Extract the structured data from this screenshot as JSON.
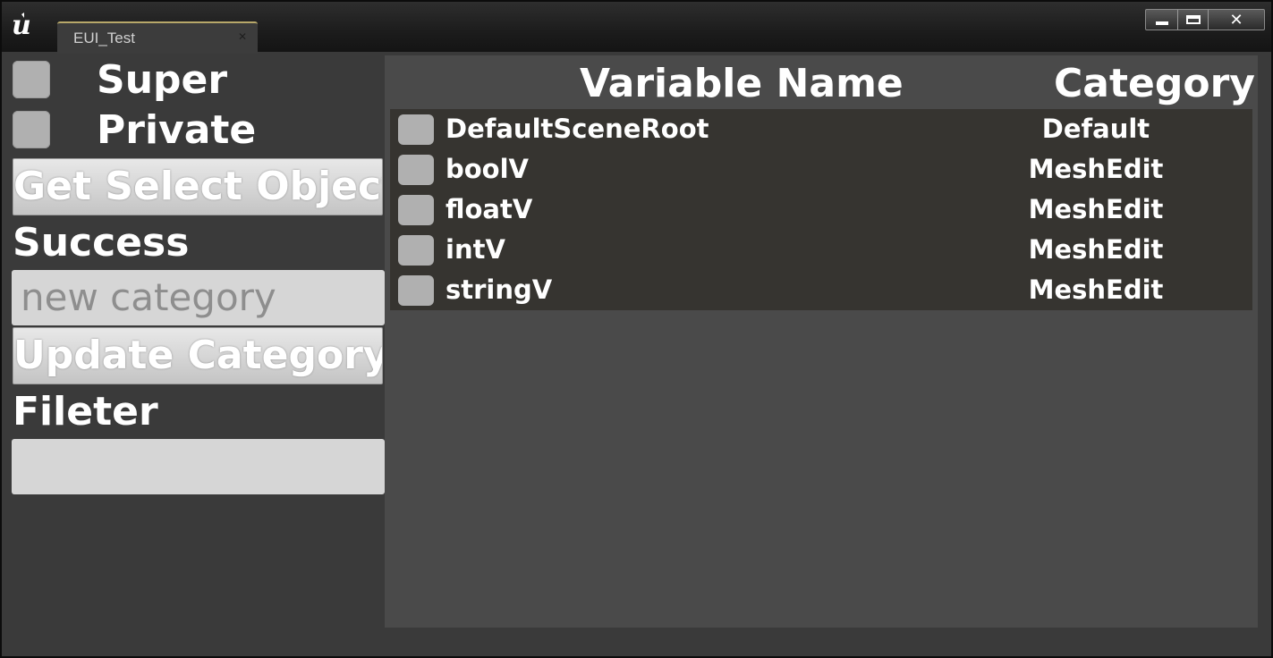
{
  "window": {
    "tab_title": "EUI_Test",
    "tab_close_icon": "close-icon",
    "controls": {
      "minimize_icon": "minimize-icon",
      "maximize_icon": "maximize-icon",
      "close_label": "✕"
    }
  },
  "left_panel": {
    "super_label": "Super",
    "private_label": "Private",
    "get_select_objects_label": "Get Select Objects",
    "status_text": "Success",
    "category_input": {
      "value": "",
      "placeholder": "new category"
    },
    "update_category_label": "Update Category",
    "filter_label": "Fileter",
    "filter_input": {
      "value": "",
      "placeholder": ""
    }
  },
  "variable_table": {
    "headers": {
      "name": "Variable Name",
      "category": "Category"
    },
    "rows": [
      {
        "name": "DefaultSceneRoot",
        "category": "Default"
      },
      {
        "name": "boolV",
        "category": "MeshEdit"
      },
      {
        "name": "floatV",
        "category": "MeshEdit"
      },
      {
        "name": "intV",
        "category": "MeshEdit"
      },
      {
        "name": "stringV",
        "category": "MeshEdit"
      }
    ]
  },
  "colors": {
    "panel_bg": "#3a3a3a",
    "list_bg": "#4a4a4a",
    "row_bg": "#363430",
    "checkbox": "#b0b0b0",
    "tab_accent": "#b8a86a"
  }
}
